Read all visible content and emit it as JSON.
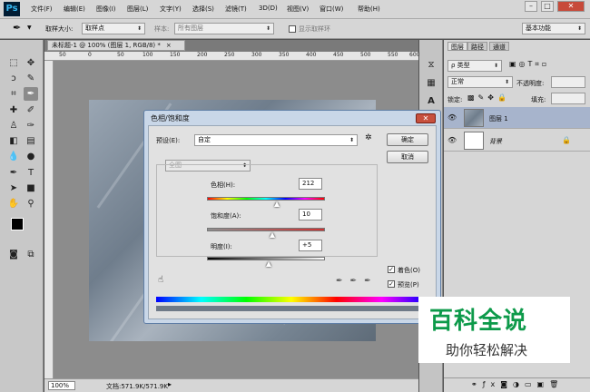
{
  "app": {
    "logo": "Ps"
  },
  "menu": [
    "文件(F)",
    "编辑(E)",
    "图像(I)",
    "图层(L)",
    "文字(Y)",
    "选择(S)",
    "滤镜(T)",
    "3D(D)",
    "视图(V)",
    "窗口(W)",
    "帮助(H)"
  ],
  "window_controls": {
    "minimize": "–",
    "restore": "□",
    "close": "✕"
  },
  "options_bar": {
    "sample_size_label": "取样大小:",
    "sample_size_value": "取样点",
    "sample_label": "样本:",
    "sample_value": "所有图层",
    "show_ring_label": "显示取样环",
    "workspace": "基本功能"
  },
  "document": {
    "tab_title": "未标题-1 @ 100% (图层 1, RGB/8) *",
    "ruler_marks": [
      "50",
      "0",
      "50",
      "100",
      "150",
      "200",
      "250",
      "300",
      "350",
      "400",
      "450",
      "500",
      "550",
      "600"
    ],
    "zoom": "100%",
    "doc_info": "文档:571.9K/571.9K"
  },
  "layers_panel": {
    "tabs": [
      "图层",
      "路径",
      "通道"
    ],
    "filter_kind": "ρ 类型",
    "blend_mode": "正常",
    "opacity_label": "不透明度:",
    "lock_label": "锁定:",
    "fill_label": "填充:",
    "layers": [
      {
        "name": "图层 1",
        "selected": true
      },
      {
        "name": "背景",
        "selected": false,
        "locked": true
      }
    ]
  },
  "dialog": {
    "title": "色相/饱和度",
    "preset_label": "预设(E):",
    "preset_value": "自定",
    "ok": "确定",
    "cancel": "取消",
    "channel": "全图",
    "hue_label": "色相(H):",
    "hue_value": "212",
    "sat_label": "饱和度(A):",
    "sat_value": "10",
    "light_label": "明度(I):",
    "light_value": "+5",
    "colorize_label": "着色(O)",
    "colorize_checked": true,
    "preview_label": "预览(P)",
    "preview_checked": true,
    "hue_slider": 0.59,
    "sat_slider": 0.55,
    "light_slider": 0.525
  },
  "watermark": {
    "line1": "百科全说",
    "line2": "助你轻松解决",
    "color": "#0d9a4a"
  }
}
